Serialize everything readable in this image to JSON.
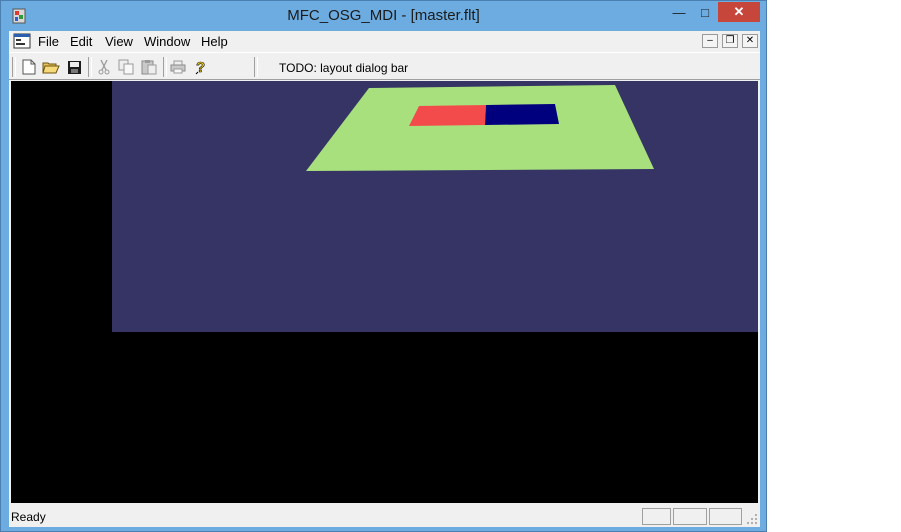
{
  "window": {
    "title": "MFC_OSG_MDI - [master.flt]"
  },
  "titlebar_buttons": {
    "minimize": "—",
    "maximize": "□",
    "close": "✕"
  },
  "menu": {
    "items": [
      "File",
      "Edit",
      "View",
      "Window",
      "Help"
    ]
  },
  "mdi_buttons": {
    "minimize": "–",
    "restore": "❐",
    "close": "✕"
  },
  "toolbar": {
    "buttons": [
      "new-icon",
      "open-icon",
      "save-icon",
      "cut-icon",
      "copy-icon",
      "paste-icon",
      "print-icon",
      "help-icon"
    ],
    "dialog_bar_text": "TODO: layout dialog bar"
  },
  "scene": {
    "background_color": "#353465",
    "ground_color": "#a8e07e",
    "box_red_color": "#f34b4b",
    "box_blue_color": "#00007f"
  },
  "status": {
    "text": "Ready"
  }
}
